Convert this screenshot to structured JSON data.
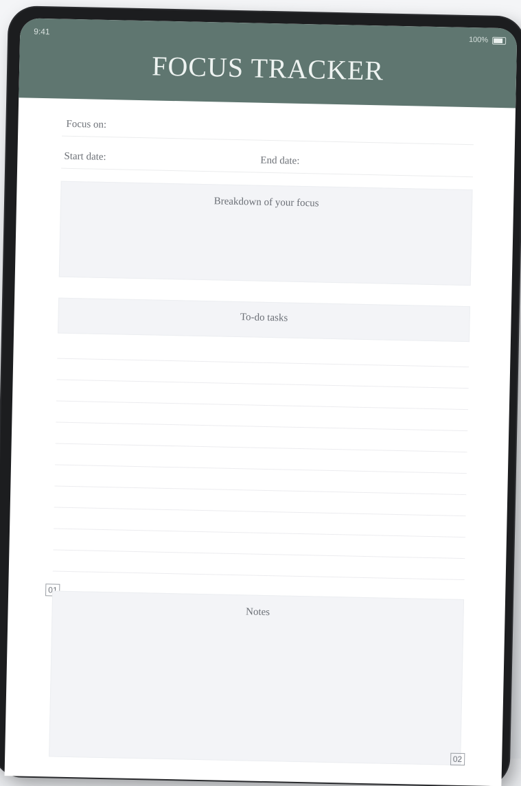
{
  "status_bar": {
    "time": "9:41",
    "battery": "100%"
  },
  "header": {
    "title": "FOCUS TRACKER"
  },
  "form": {
    "focus_on_label": "Focus on:",
    "start_date_label": "Start date:",
    "end_date_label": "End date:"
  },
  "sections": {
    "breakdown_title": "Breakdown of your focus",
    "to_do_title": "To-do tasks",
    "notes_title": "Notes"
  },
  "page_marks": {
    "top_left": "01",
    "bottom_right": "02"
  }
}
